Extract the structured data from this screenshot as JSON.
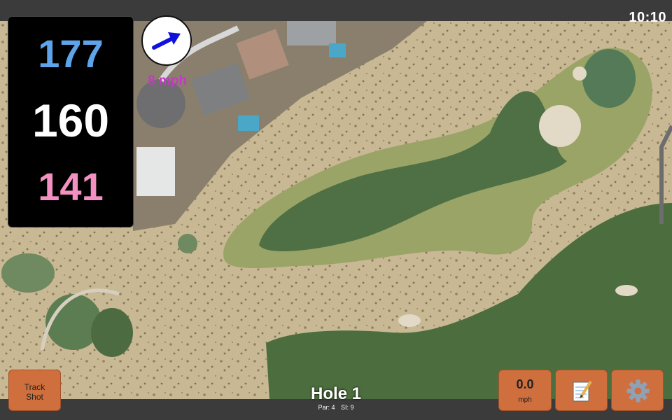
{
  "status": {
    "time": "10:10"
  },
  "distances": {
    "back": "177",
    "middle": "160",
    "front": "141"
  },
  "wind": {
    "speed_label": "8 mph",
    "direction": "arrow-right-up"
  },
  "controls": {
    "track_shot_line1": "Track",
    "track_shot_line2": "Shot",
    "speed_value": "0.0",
    "speed_unit": "mph",
    "notes_icon": "notepad-pencil-icon",
    "settings_icon": "gear-icon"
  },
  "hole": {
    "title": "Hole 1",
    "par_label": "Par: 4",
    "si_label": "SI: 9"
  },
  "colors": {
    "back_distance": "#5ea4ea",
    "middle_distance": "#ffffff",
    "front_distance": "#f48fc1",
    "wind_text": "#c23bc2",
    "button": "#cf6f3d"
  }
}
